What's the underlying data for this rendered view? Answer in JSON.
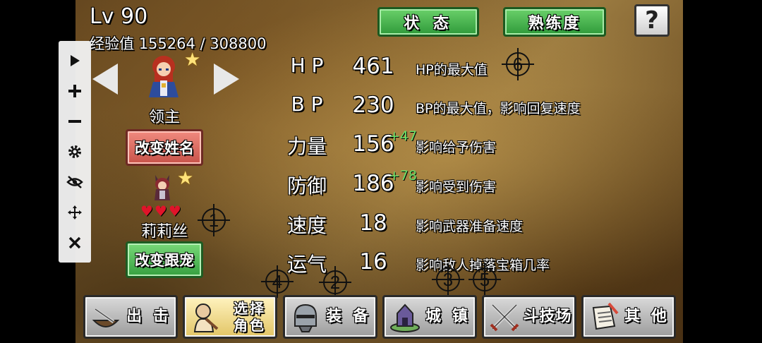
{
  "header": {
    "level": "Lv 90",
    "exp": "经验值 155264 / 308800"
  },
  "top_buttons": {
    "status": "状 态",
    "proficiency": "熟练度",
    "help": "?"
  },
  "character": {
    "role_name": "领主",
    "rename_button": "改变姓名",
    "pet_name": "莉莉丝",
    "pet_button": "改变跟宠",
    "hearts": "♥♥♥",
    "star": "★"
  },
  "stats": [
    {
      "label": "H P",
      "value": "461",
      "bonus": "",
      "desc": "HP的最大值"
    },
    {
      "label": "B P",
      "value": "230",
      "bonus": "",
      "desc": "BP的最大值，影响回复速度"
    },
    {
      "label": "力量",
      "value": "156",
      "bonus": "+47",
      "desc": "影响给予伤害"
    },
    {
      "label": "防御",
      "value": "186",
      "bonus": "+78",
      "desc": "影响受到伤害"
    },
    {
      "label": "速度",
      "value": "18",
      "bonus": "",
      "desc": "影响武器准备速度"
    },
    {
      "label": "运气",
      "value": "16",
      "bonus": "",
      "desc": "影响敌人掉落宝箱几率"
    }
  ],
  "markers": [
    "1",
    "2",
    "3",
    "4",
    "5",
    "6"
  ],
  "bottom_nav": [
    {
      "label": "出 击",
      "icon": "sortie-icon"
    },
    {
      "label": "选择角色",
      "icon": "character-select-icon"
    },
    {
      "label": "装 备",
      "icon": "equipment-icon"
    },
    {
      "label": "城 镇",
      "icon": "town-icon"
    },
    {
      "label": "斗技场",
      "icon": "arena-icon"
    },
    {
      "label": "其 他",
      "icon": "other-icon"
    }
  ],
  "toolbar": [
    "play-icon",
    "zoom-in-icon",
    "zoom-out-icon",
    "settings-icon",
    "hide-icon",
    "move-icon",
    "close-icon"
  ]
}
